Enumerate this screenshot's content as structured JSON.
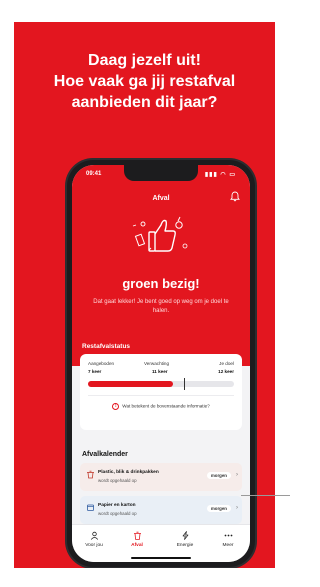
{
  "promo": {
    "headline_lines": [
      "Daag jezelf uit!",
      "Hoe vaak ga jij restafval",
      "aanbieden dit jaar?"
    ],
    "background_color": "#e3161f"
  },
  "phone": {
    "status_time": "09:41",
    "app_title": "Afval",
    "header_icon": "bell-icon",
    "status_title": "groen bezig!",
    "status_subtitle": "Dat gaat lekker! Je bent goed op weg om je doel te halen.",
    "section_restafval": "Restafvalstatus",
    "progress": {
      "labels": {
        "offered": "Aangeboden",
        "expected": "Verwachting",
        "goal": "Je doel"
      },
      "values": {
        "offered": "7 keer",
        "expected": "11 keer",
        "goal": "12 keer"
      },
      "fill_fraction": 0.58,
      "marker_fraction": 0.66,
      "info_text": "Wat betekent de bovenstaande informatie?"
    },
    "calendar": {
      "title": "Afvalkalender",
      "items": [
        {
          "name": "Plastic, blik & drinkpakken",
          "note": "wordt opgehaald op",
          "badge": "morgen",
          "icon": "bin-icon"
        },
        {
          "name": "Papier en karton",
          "note": "wordt opgehaald op",
          "badge": "morgen",
          "icon": "paper-icon"
        }
      ]
    },
    "tabs": [
      {
        "label": "Voor jou",
        "icon": "person-icon",
        "active": false
      },
      {
        "label": "Afval",
        "icon": "trash-icon",
        "active": true
      },
      {
        "label": "Energie",
        "icon": "bolt-icon",
        "active": false
      },
      {
        "label": "Meer",
        "icon": "more-icon",
        "active": false
      }
    ]
  }
}
